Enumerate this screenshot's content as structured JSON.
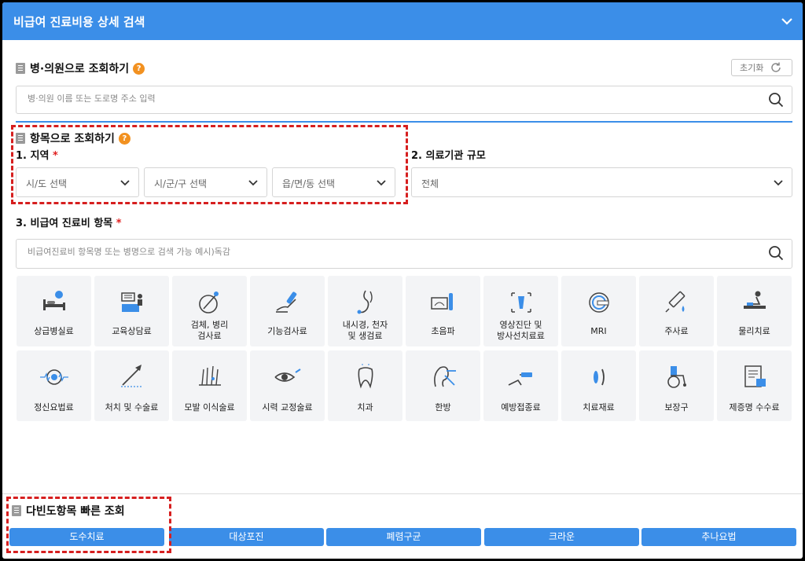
{
  "header": {
    "title": "비급여 진료비용 상세 검색"
  },
  "hospital_search": {
    "title": "병·의원으로 조회하기",
    "reset_label": "초기화",
    "placeholder": "병·의원 이름 또는 도로명 주소 입력"
  },
  "item_search": {
    "title": "항목으로 조회하기",
    "region_label": "1. 지역",
    "required_mark": "*",
    "region_selects": [
      "시/도 선택",
      "시/군/구 선택",
      "읍/면/동 선택"
    ],
    "scale_label": "2. 의료기관 규모",
    "scale_value": "전체",
    "items_label": "3. 비급여 진료비 항목",
    "items_placeholder": "비급여진료비 항목명 또는 병명으로 검색 가능 예시)독감"
  },
  "categories": [
    {
      "label": "상급병실료",
      "icon": "hospital-bed-icon"
    },
    {
      "label": "교육상담료",
      "icon": "consultation-icon"
    },
    {
      "label": "검체, 병리\n검사료",
      "icon": "specimen-icon"
    },
    {
      "label": "기능검사료",
      "icon": "function-test-icon"
    },
    {
      "label": "내시경, 천자\n및 생검료",
      "icon": "endoscope-icon"
    },
    {
      "label": "초음파",
      "icon": "ultrasound-icon"
    },
    {
      "label": "영상진단 및\n방사선치료료",
      "icon": "radiology-icon"
    },
    {
      "label": "MRI",
      "icon": "mri-icon"
    },
    {
      "label": "주사료",
      "icon": "syringe-icon"
    },
    {
      "label": "물리치료",
      "icon": "physical-therapy-icon"
    },
    {
      "label": "정신요법료",
      "icon": "brain-icon"
    },
    {
      "label": "처치 및 수술료",
      "icon": "surgery-icon"
    },
    {
      "label": "모발 이식술료",
      "icon": "hair-transplant-icon"
    },
    {
      "label": "시력 교정술료",
      "icon": "eye-icon"
    },
    {
      "label": "치과",
      "icon": "tooth-icon"
    },
    {
      "label": "한방",
      "icon": "acupuncture-icon"
    },
    {
      "label": "예방접종료",
      "icon": "vaccination-icon"
    },
    {
      "label": "치료재료",
      "icon": "treatment-material-icon"
    },
    {
      "label": "보장구",
      "icon": "wheelchair-icon"
    },
    {
      "label": "제증명 수수료",
      "icon": "certificate-icon"
    }
  ],
  "quick_lookup": {
    "title": "다빈도항목 빠른 조회",
    "buttons": [
      "도수치료",
      "대상포진",
      "폐렴구균",
      "크라운",
      "추나요법"
    ]
  },
  "colors": {
    "accent": "#3b8ee8",
    "help": "#f29120",
    "highlight": "#d61f1f"
  }
}
